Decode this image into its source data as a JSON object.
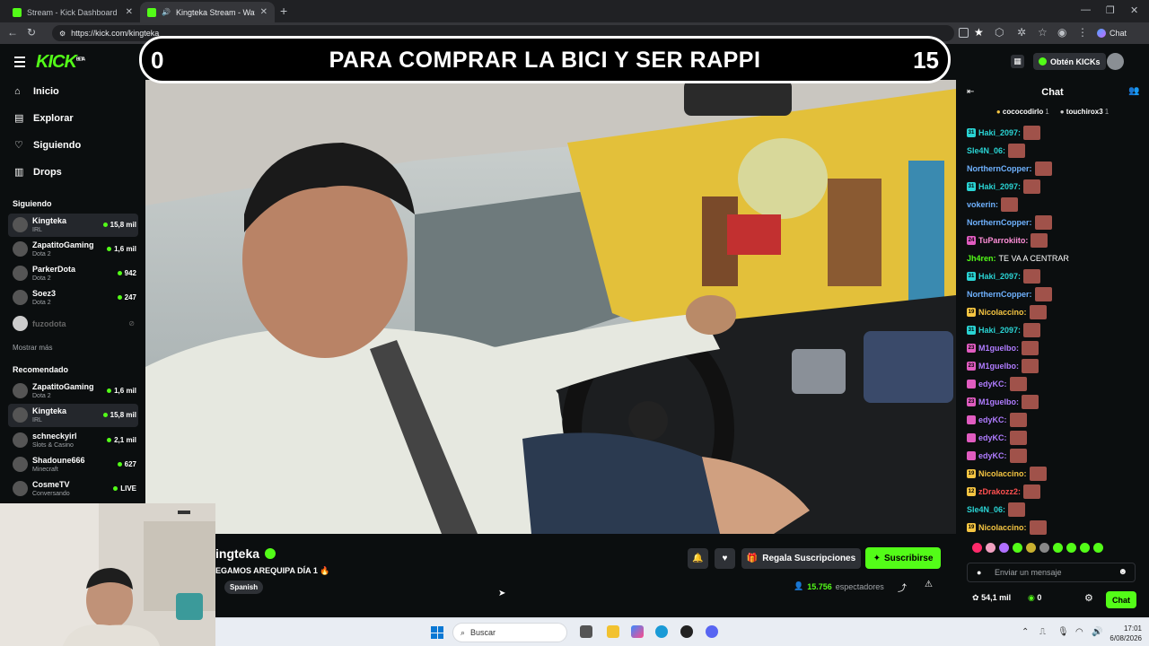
{
  "browser": {
    "tabs": [
      {
        "title": "Stream - Kick Dashboard",
        "active": false
      },
      {
        "title": "Kingteka Stream - Watch Live",
        "active": true
      }
    ],
    "url": "https://kick.com/kingteka",
    "toolbar_chat_label": "Chat"
  },
  "header": {
    "logo": "KICK",
    "logo_beta": "BETA",
    "get_kicks_label": "Obtén KICKs"
  },
  "overlay": {
    "left_count": "0",
    "text": "PARA COMPRAR LA BICI Y SER RAPPI",
    "right_count": "15"
  },
  "sidebar": {
    "nav": [
      {
        "label": "Inicio",
        "icon": "home-icon"
      },
      {
        "label": "Explorar",
        "icon": "compass-icon"
      },
      {
        "label": "Siguiendo",
        "icon": "heart-icon"
      },
      {
        "label": "Drops",
        "icon": "gift-icon"
      }
    ],
    "following_title": "Siguiendo",
    "following": [
      {
        "name": "Kingteka",
        "category": "IRL",
        "viewers": "15,8 mil",
        "selected": true
      },
      {
        "name": "ZapatitoGaming",
        "category": "Dota 2",
        "viewers": "1,6 mil"
      },
      {
        "name": "ParkerDota",
        "category": "Dota 2",
        "viewers": "942"
      },
      {
        "name": "Soez3",
        "category": "Dota 2",
        "viewers": "247"
      },
      {
        "name": "fuzodota",
        "category": "",
        "viewers": "",
        "offline": true
      }
    ],
    "show_more": "Mostrar más",
    "recommended_title": "Recomendado",
    "recommended": [
      {
        "name": "ZapatitoGaming",
        "category": "Dota 2",
        "viewers": "1,6 mil"
      },
      {
        "name": "Kingteka",
        "category": "IRL",
        "viewers": "15,8 mil",
        "selected": true
      },
      {
        "name": "schneckyirl",
        "category": "Slots & Casino",
        "viewers": "2,1 mil"
      },
      {
        "name": "Shadoune666",
        "category": "Minecraft",
        "viewers": "627"
      },
      {
        "name": "CosmeTV",
        "category": "Conversando",
        "viewers": "LIVE"
      }
    ]
  },
  "stream": {
    "streamer": "ingteka",
    "title": "EGAMOS AREQUIPA DÍA 1 🔥",
    "language": "Spanish",
    "gift_subs_label": "Regala Suscripciones",
    "subscribe_label": "Suscribirse",
    "viewers": "15.756",
    "viewers_label": "espectadores"
  },
  "chat": {
    "title": "Chat",
    "pinned": [
      {
        "name": "cococodirlo",
        "count": "1"
      },
      {
        "name": "touchirox3",
        "count": "1"
      }
    ],
    "messages": [
      {
        "badge": "31",
        "badge_color": "#2ad4d4",
        "user": "Haki_2097:",
        "color": "#2ad4d4",
        "text": "",
        "emote": true
      },
      {
        "badge": "",
        "badge_color": "",
        "user": "Sle4N_06:",
        "color": "#2ad4d4",
        "text": "",
        "emote": true
      },
      {
        "badge": "",
        "badge_color": "",
        "user": "NorthernCopper:",
        "color": "#6fb2ff",
        "text": "",
        "emote": true
      },
      {
        "badge": "31",
        "badge_color": "#2ad4d4",
        "user": "Haki_2097:",
        "color": "#2ad4d4",
        "text": "",
        "emote": true
      },
      {
        "badge": "",
        "badge_color": "",
        "user": "vokerin:",
        "color": "#6fb2ff",
        "text": "",
        "emote": true
      },
      {
        "badge": "",
        "badge_color": "",
        "user": "NorthernCopper:",
        "color": "#6fb2ff",
        "text": "",
        "emote": true
      },
      {
        "badge": "24",
        "badge_color": "#e05cc0",
        "user": "TuParrokiito:",
        "color": "#ff8fd8",
        "text": "",
        "emote": true
      },
      {
        "badge": "",
        "badge_color": "",
        "user": "Jh4ren:",
        "color": "#53fc18",
        "text": "TE VA A CENTRAR",
        "emote": false
      },
      {
        "badge": "31",
        "badge_color": "#2ad4d4",
        "user": "Haki_2097:",
        "color": "#2ad4d4",
        "text": "",
        "emote": true
      },
      {
        "badge": "",
        "badge_color": "",
        "user": "NorthernCopper:",
        "color": "#6fb2ff",
        "text": "",
        "emote": true
      },
      {
        "badge": "19",
        "badge_color": "#f5c542",
        "user": "Nicolaccino:",
        "color": "#f5c542",
        "text": "",
        "emote": true
      },
      {
        "badge": "31",
        "badge_color": "#2ad4d4",
        "user": "Haki_2097:",
        "color": "#2ad4d4",
        "text": "",
        "emote": true
      },
      {
        "badge": "23",
        "badge_color": "#e05cc0",
        "user": "M1guelbo:",
        "color": "#b07cff",
        "text": "",
        "emote": true
      },
      {
        "badge": "23",
        "badge_color": "#e05cc0",
        "user": "M1guelbo:",
        "color": "#b07cff",
        "text": "",
        "emote": true
      },
      {
        "badge": "",
        "badge_color": "#e05cc0",
        "user": "edyKC:",
        "color": "#b07cff",
        "text": "",
        "emote": true
      },
      {
        "badge": "23",
        "badge_color": "#e05cc0",
        "user": "M1guelbo:",
        "color": "#b07cff",
        "text": "",
        "emote": true
      },
      {
        "badge": "",
        "badge_color": "#e05cc0",
        "user": "edyKC:",
        "color": "#b07cff",
        "text": "",
        "emote": true
      },
      {
        "badge": "",
        "badge_color": "#e05cc0",
        "user": "edyKC:",
        "color": "#b07cff",
        "text": "",
        "emote": true
      },
      {
        "badge": "",
        "badge_color": "#e05cc0",
        "user": "edyKC:",
        "color": "#b07cff",
        "text": "",
        "emote": true
      },
      {
        "badge": "19",
        "badge_color": "#f5c542",
        "user": "Nicolaccino:",
        "color": "#f5c542",
        "text": "",
        "emote": true
      },
      {
        "badge": "12",
        "badge_color": "#f5c542",
        "user": "zDrakozz2:",
        "color": "#ff5050",
        "text": "",
        "emote": true
      },
      {
        "badge": "",
        "badge_color": "",
        "user": "Sle4N_06:",
        "color": "#2ad4d4",
        "text": "",
        "emote": true
      },
      {
        "badge": "19",
        "badge_color": "#f5c542",
        "user": "Nicolaccino:",
        "color": "#f5c542",
        "text": "",
        "emote": true
      }
    ],
    "input_placeholder": "Enviar un mensaje",
    "kicks_balance": "54,1 mil",
    "points": "0",
    "send_label": "Chat"
  },
  "taskbar": {
    "search_placeholder": "Buscar",
    "time": "17:01",
    "date": "6/08/2026"
  },
  "colors": {
    "kick_green": "#53fc18",
    "background": "#0b0e0f"
  }
}
